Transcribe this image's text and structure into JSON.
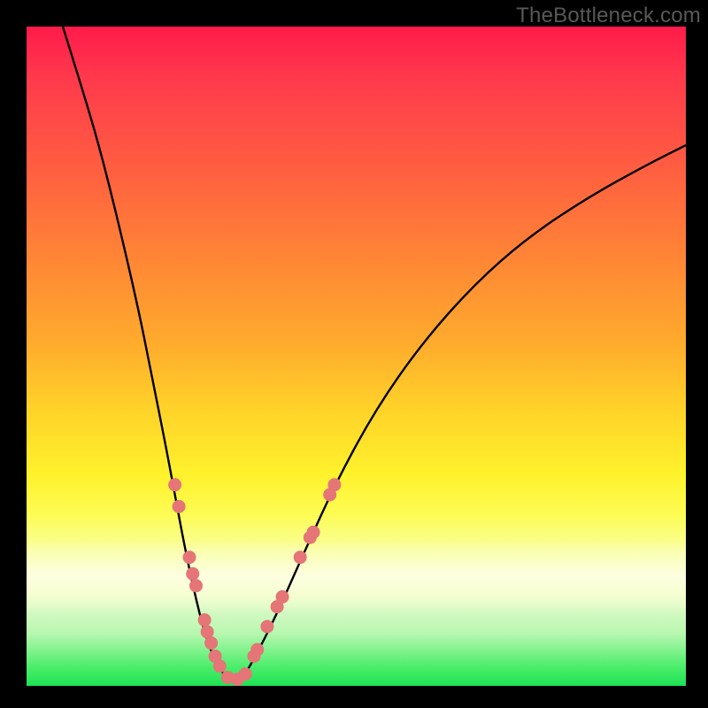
{
  "watermark": "TheBottleneck.com",
  "chart_data": {
    "type": "line",
    "title": "",
    "xlabel": "",
    "ylabel": "",
    "xlim": [
      0,
      100
    ],
    "ylim": [
      0,
      100
    ],
    "grid": false,
    "curve_left": [
      {
        "x": 5.5,
        "y": 100
      },
      {
        "x": 8,
        "y": 92
      },
      {
        "x": 11,
        "y": 82
      },
      {
        "x": 14,
        "y": 70
      },
      {
        "x": 17,
        "y": 57
      },
      {
        "x": 19,
        "y": 47
      },
      {
        "x": 21,
        "y": 37
      },
      {
        "x": 22.5,
        "y": 29
      },
      {
        "x": 24,
        "y": 21
      },
      {
        "x": 25.5,
        "y": 14
      },
      {
        "x": 27,
        "y": 8
      },
      {
        "x": 28.5,
        "y": 4
      },
      {
        "x": 30,
        "y": 1.5
      },
      {
        "x": 31.5,
        "y": 0.5
      }
    ],
    "curve_right": [
      {
        "x": 31.5,
        "y": 0.5
      },
      {
        "x": 33,
        "y": 1.5
      },
      {
        "x": 35,
        "y": 5
      },
      {
        "x": 38,
        "y": 11
      },
      {
        "x": 42,
        "y": 20
      },
      {
        "x": 47,
        "y": 31
      },
      {
        "x": 53,
        "y": 42
      },
      {
        "x": 60,
        "y": 52
      },
      {
        "x": 68,
        "y": 61
      },
      {
        "x": 76,
        "y": 68
      },
      {
        "x": 85,
        "y": 74
      },
      {
        "x": 94,
        "y": 79
      },
      {
        "x": 100,
        "y": 82
      }
    ],
    "dots": [
      {
        "x": 22.5,
        "y": 30.5
      },
      {
        "x": 23.1,
        "y": 27.2
      },
      {
        "x": 24.7,
        "y": 19.5
      },
      {
        "x": 25.2,
        "y": 17.0
      },
      {
        "x": 25.7,
        "y": 15.2
      },
      {
        "x": 27.0,
        "y": 10.0
      },
      {
        "x": 27.4,
        "y": 8.2
      },
      {
        "x": 28.0,
        "y": 6.5
      },
      {
        "x": 28.6,
        "y": 4.5
      },
      {
        "x": 29.3,
        "y": 3.0
      },
      {
        "x": 30.5,
        "y": 1.3
      },
      {
        "x": 32.0,
        "y": 1.0
      },
      {
        "x": 33.2,
        "y": 1.8
      },
      {
        "x": 34.5,
        "y": 4.5
      },
      {
        "x": 35.0,
        "y": 5.5
      },
      {
        "x": 36.5,
        "y": 9.0
      },
      {
        "x": 38.0,
        "y": 12.0
      },
      {
        "x": 38.8,
        "y": 13.5
      },
      {
        "x": 41.5,
        "y": 19.5
      },
      {
        "x": 43.0,
        "y": 22.5
      },
      {
        "x": 43.5,
        "y": 23.3
      },
      {
        "x": 46.0,
        "y": 29.0
      },
      {
        "x": 46.7,
        "y": 30.5
      }
    ],
    "dot_radius_px": 7
  },
  "colors": {
    "curve": "#000000",
    "dot": "#e57577",
    "frame": "#000000"
  }
}
